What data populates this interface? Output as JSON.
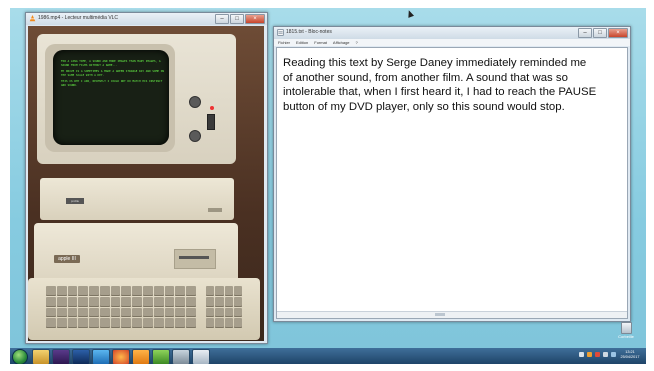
{
  "vlc": {
    "title": "1986.mp4 - Lecteur multimédia VLC",
    "video_text": [
      "FOR A LONG TIME, A SOUND AND MORE IMAGES THAN MANY IMAGES, A SOUND FROM FILMS WITHOUT A NAME...",
      "MY DRIVE IS A SOMETIMES A MADE A GREEN STRANGE DAY AND SOME ON THE SAME SCALE WITH A KEY.",
      "THIS IS WHY I ADD, RECENTLY I COULD NOT DO MATCH HIS INSTINCT AND SOUND."
    ],
    "case_logo": "apple III",
    "drive_badge": "profile"
  },
  "notepad": {
    "title": "1815.txt - Bloc-notes",
    "menus": [
      "Fichier",
      "Edition",
      "Format",
      "Affichage",
      "?"
    ],
    "text": "Reading this text by Serge Daney immediately reminded me\nof another sound, from another film. A sound that was so\nintolerable that, when I first heard it, I had to reach the PAUSE\nbutton of my DVD player, only so this sound would stop."
  },
  "desktop": {
    "icon_label": "Corbeille"
  },
  "taskbar": {
    "apps": [
      "explorer",
      "premiere",
      "photoshop",
      "ie",
      "firefox",
      "vlc",
      "winamp",
      "utorrent",
      "notepad"
    ],
    "clock_time": "13:21",
    "clock_date": "25/04/2017"
  },
  "colors": {
    "desktop": "#8fd0e2",
    "crt_text": "#6cff4a",
    "taskbar": "#1e4468"
  }
}
